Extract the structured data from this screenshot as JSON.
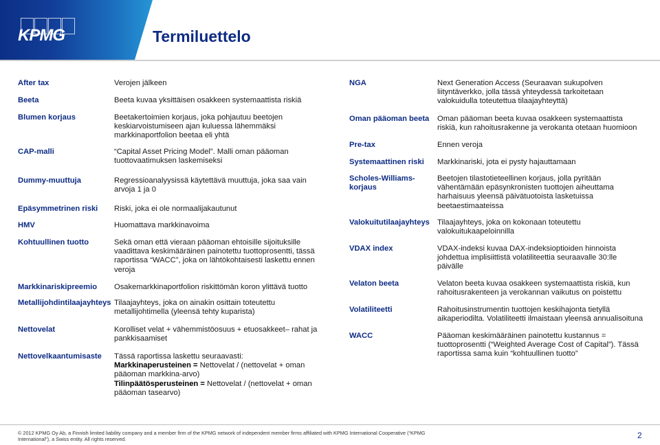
{
  "header": {
    "logo_text": "KPMG",
    "title": "Termiluettelo",
    "colors": {
      "brand_dark": "#0b2f86",
      "brand_light": "#2596d6",
      "title": "#0d2b84"
    }
  },
  "left_column": [
    {
      "term": "After tax",
      "definition": "Verojen jälkeen"
    },
    {
      "term": "Beeta",
      "definition": "Beeta kuvaa yksittäisen osakkeen systemaattista riskiä"
    },
    {
      "term": "Blumen korjaus",
      "definition": "Beetakertoimien korjaus, joka pohjautuu beetojen keskiarvoistumiseen ajan kuluessa lähemmäksi markkinaportfolion beetaa eli yhtä"
    },
    {
      "term": "CAP-malli",
      "definition": "“Capital Asset Pricing Model”. Malli oman pääoman tuottovaatimuksen laskemiseksi"
    },
    {
      "term": "Dummy-muuttuja",
      "definition": "Regressioanalyysissä käytettävä muuttuja, joka saa vain arvoja 1 ja 0"
    },
    {
      "term": "Epäsymmetrinen riski",
      "definition": "Riski, joka ei ole normaalijakautunut"
    },
    {
      "term": "HMV",
      "definition": "Huomattava markkinavoima"
    },
    {
      "term": "Kohtuullinen tuotto",
      "definition": "Sekä oman että vieraan pääoman ehtoisille sijoituksille vaadittava keskimääräinen painotettu tuottoprosentti, tässä raportissa “WACC”, joka on lähtökohtaisesti laskettu ennen veroja"
    },
    {
      "term": "Markkinariskipreemio",
      "definition": "Osakemarkkinaportfolion riskittömän koron ylittävä tuotto"
    },
    {
      "term": "Metallijohdintilaajayhteys",
      "definition": "Tilaajayhteys, joka on ainakin osittain toteutettu metallijohtimella (yleensä tehty kuparista)"
    },
    {
      "term": "Nettovelat",
      "definition": "Korolliset velat + vähemmistöosuus + etuosakkeet– rahat ja pankkisaamiset"
    },
    {
      "term": "Nettovelkaantumisaste",
      "definition_intro": "Tässä raportissa laskettu seuraavasti:",
      "formula1_label": "Markkinaperusteinen =",
      "formula1_text": " Nettovelat / (nettovelat + oman pääoman markkina-arvo)",
      "formula2_label": "Tilinpäätösperusteinen =",
      "formula2_text": " Nettovelat / (nettovelat + oman pääoman tasearvo)"
    }
  ],
  "right_column": [
    {
      "term": "NGA",
      "definition": "Next Generation Access (Seuraavan sukupolven liityntäverkko, jolla tässä yhteydessä tarkoitetaan valokuidulla toteutettua tilaajayhteyttä)"
    },
    {
      "term": "Oman pääoman beeta",
      "definition": "Oman pääoman beeta kuvaa osakkeen systemaattista riskiä, kun rahoitusrakenne ja verokanta otetaan huomioon"
    },
    {
      "term": "Pre-tax",
      "definition": "Ennen veroja"
    },
    {
      "term": "Systemaattinen riski",
      "definition": "Markkinariski, jota ei pysty hajauttamaan"
    },
    {
      "term": "Scholes-Williams-korjaus",
      "definition": "Beetojen tilastotieteellinen korjaus, jolla pyritään vähentämään epäsynkronisten tuottojen aiheuttama harhaisuus yleensä päivätuotoista lasketuissa beetaestimaateissa"
    },
    {
      "term": "Valokuitutilaajayhteys",
      "definition": "Tilaajayhteys, joka on kokonaan toteutettu valokuitukaapeloinnilla"
    },
    {
      "term": "VDAX index",
      "definition": "VDAX-indeksi kuvaa DAX-indeksioptioiden hinnoista johdettua implisiittistä volatiliteettia seuraavalle 30:lle päivälle"
    },
    {
      "term": "Velaton beeta",
      "definition": "Velaton beeta kuvaa osakkeen systemaattista riskiä, kun rahoitusrakenteen ja verokannan vaikutus on poistettu"
    },
    {
      "term": "Volatiliteetti",
      "definition": "Rahoitusinstrumentin tuottojen keskihajonta tietyllä aikaperiodilta. Volatiliteetti ilmaistaan yleensä annualisoituna"
    },
    {
      "term": "WACC",
      "definition": "Pääoman keskimääräinen painotettu kustannus = tuottoprosentti (“Weighted Average Cost of Capital”). Tässä raportissa sama kuin “kohtuullinen tuotto”"
    }
  ],
  "footer": {
    "copyright": "© 2012 KPMG Oy Ab, a Finnish limited liability company and a member firm of the KPMG network of independent member firms affiliated with KPMG International Cooperative (“KPMG International”), a Swiss entity.  All rights reserved.",
    "page_number": "2"
  }
}
